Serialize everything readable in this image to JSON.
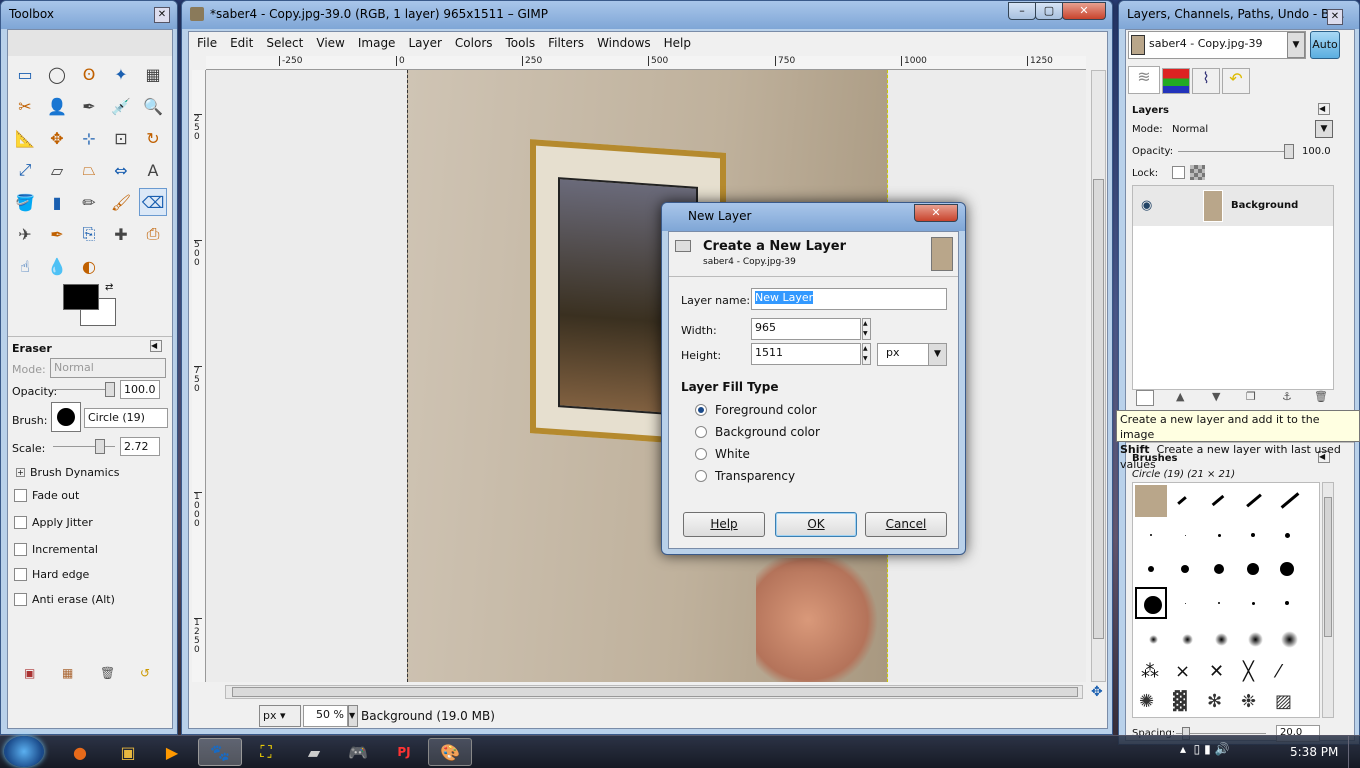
{
  "toolbox": {
    "title": "Toolbox",
    "tool_options": {
      "title": "Eraser",
      "mode_label": "Mode:",
      "mode_value": "Normal",
      "opacity_label": "Opacity:",
      "opacity_value": "100.0",
      "brush_label": "Brush:",
      "brush_value": "Circle (19)",
      "scale_label": "Scale:",
      "scale_value": "2.72",
      "dynamics_label": "Brush Dynamics",
      "checkboxes": [
        "Fade out",
        "Apply Jitter",
        "Incremental",
        "Hard edge",
        "Anti erase  (Alt)"
      ]
    },
    "tools": [
      "rect-select",
      "ellipse-select",
      "free-select",
      "fuzzy-select",
      "color-select",
      "scissors",
      "foreground-select",
      "paths",
      "color-picker",
      "zoom",
      "measure",
      "move",
      "align",
      "crop",
      "rotate",
      "scale",
      "shear",
      "perspective",
      "flip",
      "text",
      "bucket-fill",
      "blend",
      "pencil",
      "paintbrush",
      "eraser",
      "airbrush",
      "ink",
      "clone",
      "heal",
      "perspective-clone",
      "smudge",
      "blur",
      "dodge-burn"
    ],
    "colors": {
      "foreground": "#000000",
      "background": "#ffffff"
    }
  },
  "image_window": {
    "title": "*saber4 - Copy.jpg-39.0 (RGB, 1 layer) 965x1511 – GIMP",
    "menu": [
      "File",
      "Edit",
      "Select",
      "View",
      "Image",
      "Layer",
      "Colors",
      "Tools",
      "Filters",
      "Windows",
      "Help"
    ],
    "ruler_top": [
      "-250",
      "0",
      "250",
      "500",
      "750",
      "1000",
      "1250"
    ],
    "ruler_left": [
      "250",
      "500",
      "750",
      "1000",
      "1250"
    ],
    "status": {
      "unit": "px",
      "zoom": "50 %",
      "info": "Background (19.0 MB)"
    }
  },
  "dialog": {
    "title": "New Layer",
    "header": "Create a New Layer",
    "subheader": "saber4 - Copy.jpg-39",
    "layer_name_label": "Layer name:",
    "layer_name_value": "New Layer",
    "width_label": "Width:",
    "width_value": "965",
    "height_label": "Height:",
    "height_value": "1511",
    "unit": "px",
    "fill_type_title": "Layer Fill Type",
    "fill_options": [
      "Foreground color",
      "Background color",
      "White",
      "Transparency"
    ],
    "fill_selected": "Foreground color",
    "help": "Help",
    "ok": "OK",
    "cancel": "Cancel"
  },
  "layers_panel": {
    "title": "Layers, Channels, Paths, Undo - Br...",
    "image_select": "saber4 - Copy.jpg-39",
    "auto": "Auto",
    "section": "Layers",
    "mode_label": "Mode:",
    "mode_value": "Normal",
    "opacity_label": "Opacity:",
    "opacity_value": "100.0",
    "lock_label": "Lock:",
    "layers": [
      {
        "name": "Background",
        "visible": true
      }
    ]
  },
  "tooltip": {
    "line1": "Create a new layer and add it to the image",
    "shift_key": "Shift",
    "line2": "Create a new layer with last used values"
  },
  "brushes_panel": {
    "title": "Brushes",
    "current": "Circle (19)  (21 × 21)",
    "spacing_label": "Spacing:",
    "spacing_value": "20.0"
  },
  "taskbar": {
    "time": "5:38 PM"
  }
}
